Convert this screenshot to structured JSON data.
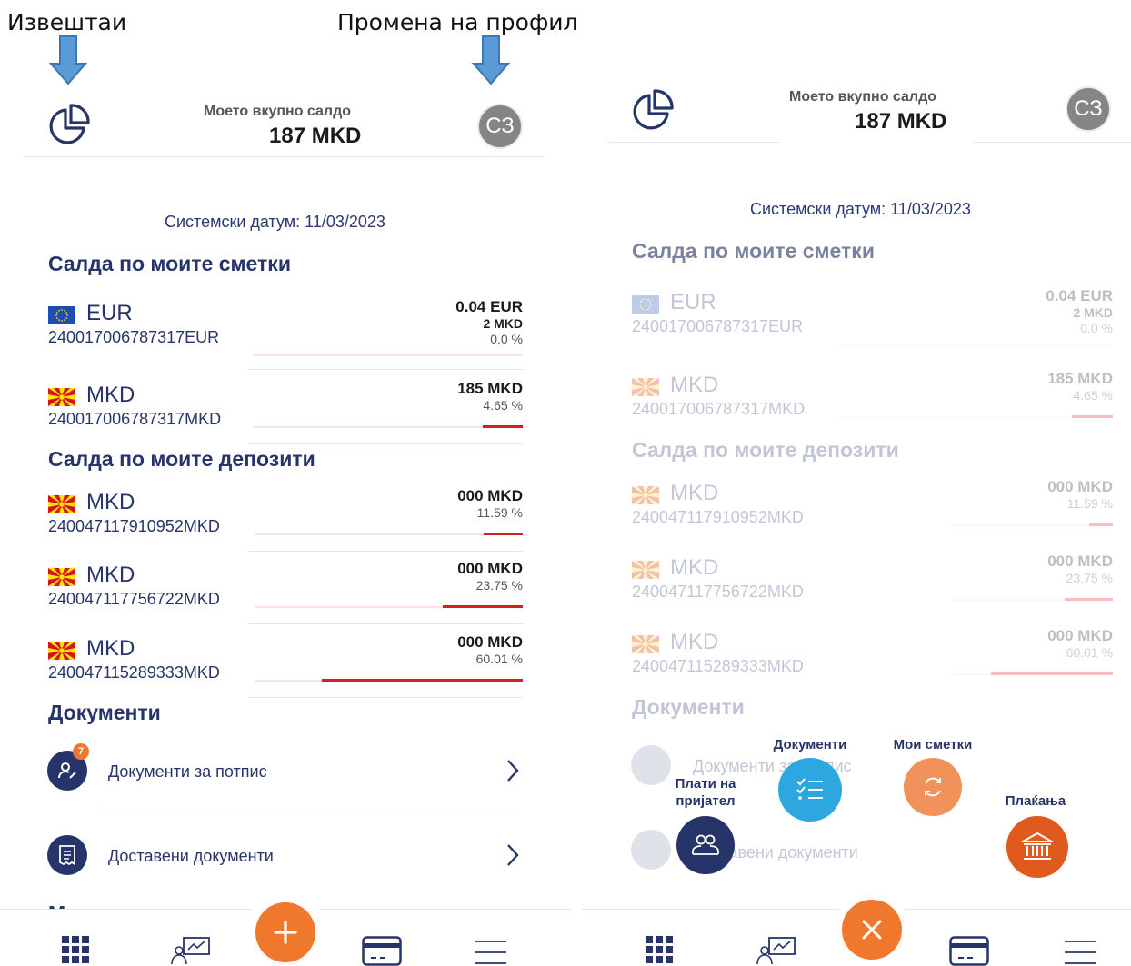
{
  "annotations": {
    "reports": "Извештаи",
    "change_profile": "Промена на профил"
  },
  "header": {
    "label": "Моето вкупно салдо",
    "amount": "187 MKD",
    "avatar": "СЗ",
    "icon": "pie-chart-icon"
  },
  "system_date": "Системски датум: 11/03/2023",
  "accounts_section": "Салда по моите сметки",
  "deposits_section": "Салда по моите депозити",
  "documents_section": "Документи",
  "cards_section": "Мои картички",
  "left": {
    "accounts": [
      {
        "currency": "EUR",
        "number": "240017006787317EUR",
        "amount": "0.04 EUR",
        "sub": "2 MKD",
        "percent": "0.0 %",
        "share": 0.0,
        "flag": "eu"
      },
      {
        "currency": "MKD",
        "number": "240017006787317MKD",
        "amount": "185 MKD",
        "sub": "",
        "percent": "4.65 %",
        "share": 4.65,
        "flag": "mk"
      }
    ],
    "deposits": [
      {
        "currency": "MKD",
        "number": "240047117910952MKD",
        "amount": "000 MKD",
        "percent": "11.59 %",
        "share": 11.59,
        "flag": "mk"
      },
      {
        "currency": "MKD",
        "number": "240047117756722MKD",
        "amount": "000 MKD",
        "percent": "23.75 %",
        "share": 23.75,
        "flag": "mk"
      },
      {
        "currency": "MKD",
        "number": "240047115289333MKD",
        "amount": "000 MKD",
        "percent": "60.01 %",
        "share": 60.01,
        "flag": "mk"
      }
    ]
  },
  "right": {
    "accounts": [
      {
        "currency": "EUR",
        "number": "240017006787317EUR",
        "amount": "0.04 EUR",
        "sub": "2 MKD",
        "percent": "0.0 %",
        "share": 0.0,
        "flag": "eu"
      },
      {
        "currency": "MKD",
        "number": "240017006787317MKD",
        "amount": "185 MKD",
        "sub": "",
        "percent": "4.65 %",
        "share": 4.65,
        "flag": "mk"
      }
    ],
    "deposits": [
      {
        "currency": "MKD",
        "number": "240047117910952MKD",
        "amount": "000 MKD",
        "percent": "11.59 %",
        "share": 11.59,
        "flag": "mk"
      },
      {
        "currency": "MKD",
        "number": "240047117756722MKD",
        "amount": "000 MKD",
        "percent": "23.75 %",
        "share": 23.75,
        "flag": "mk"
      },
      {
        "currency": "MKD",
        "number": "240047115289333MKD",
        "amount": "000 MKD",
        "percent": "60.01 %",
        "share": 60.01,
        "flag": "mk"
      }
    ]
  },
  "documents": [
    {
      "label": "Документи за потпис",
      "badge": "7",
      "icon": "signature-user-icon"
    },
    {
      "label": "Доставени документи",
      "icon": "receipt-icon"
    }
  ],
  "fab_menu": {
    "pay_friend": "Плати на пријател",
    "documents": "Документи",
    "my_accounts": "Мои сметки",
    "payments": "Плаќања"
  },
  "bottom_nav": [
    "grid-icon",
    "chart-board-icon",
    "plus-icon",
    "card-icon",
    "menu-icon"
  ],
  "colors": {
    "navy": "#27346a",
    "accent_orange": "#f0782c",
    "red": "#d71f1f",
    "blue_fab": "#2ea7e0",
    "orange_fab": "#f0925a",
    "bank_fab": "#e05a1e"
  }
}
